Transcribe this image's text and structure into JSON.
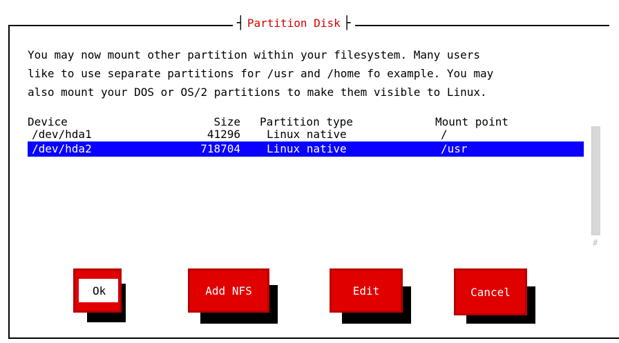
{
  "dialog": {
    "title_left_bar": "┤",
    "title": "Partition Disk",
    "title_right_bar": "├",
    "message": "You may now mount other partition within your filesystem. Many users\nlike to use separate partitions for /usr and /home fo example. You may\nalso mount your DOS or OS/2 partitions to make them visible to Linux."
  },
  "table": {
    "headers": {
      "device": "Device",
      "size": "Size",
      "type": "Partition type",
      "mount": "Mount point"
    },
    "rows": [
      {
        "device": "/dev/hda1",
        "size": "41296",
        "type": "Linux native",
        "mount": "/",
        "selected": false
      },
      {
        "device": "/dev/hda2",
        "size": "718704",
        "type": "Linux native",
        "mount": "/usr",
        "selected": true
      }
    ]
  },
  "scrollbar": {
    "mark": "#"
  },
  "buttons": {
    "ok": "Ok",
    "add_nfs": "Add NFS",
    "edit": "Edit",
    "cancel": "Cancel"
  },
  "colors": {
    "accent_red": "#e00000",
    "selection_blue": "#0a00ff",
    "title_red": "#d40000"
  }
}
